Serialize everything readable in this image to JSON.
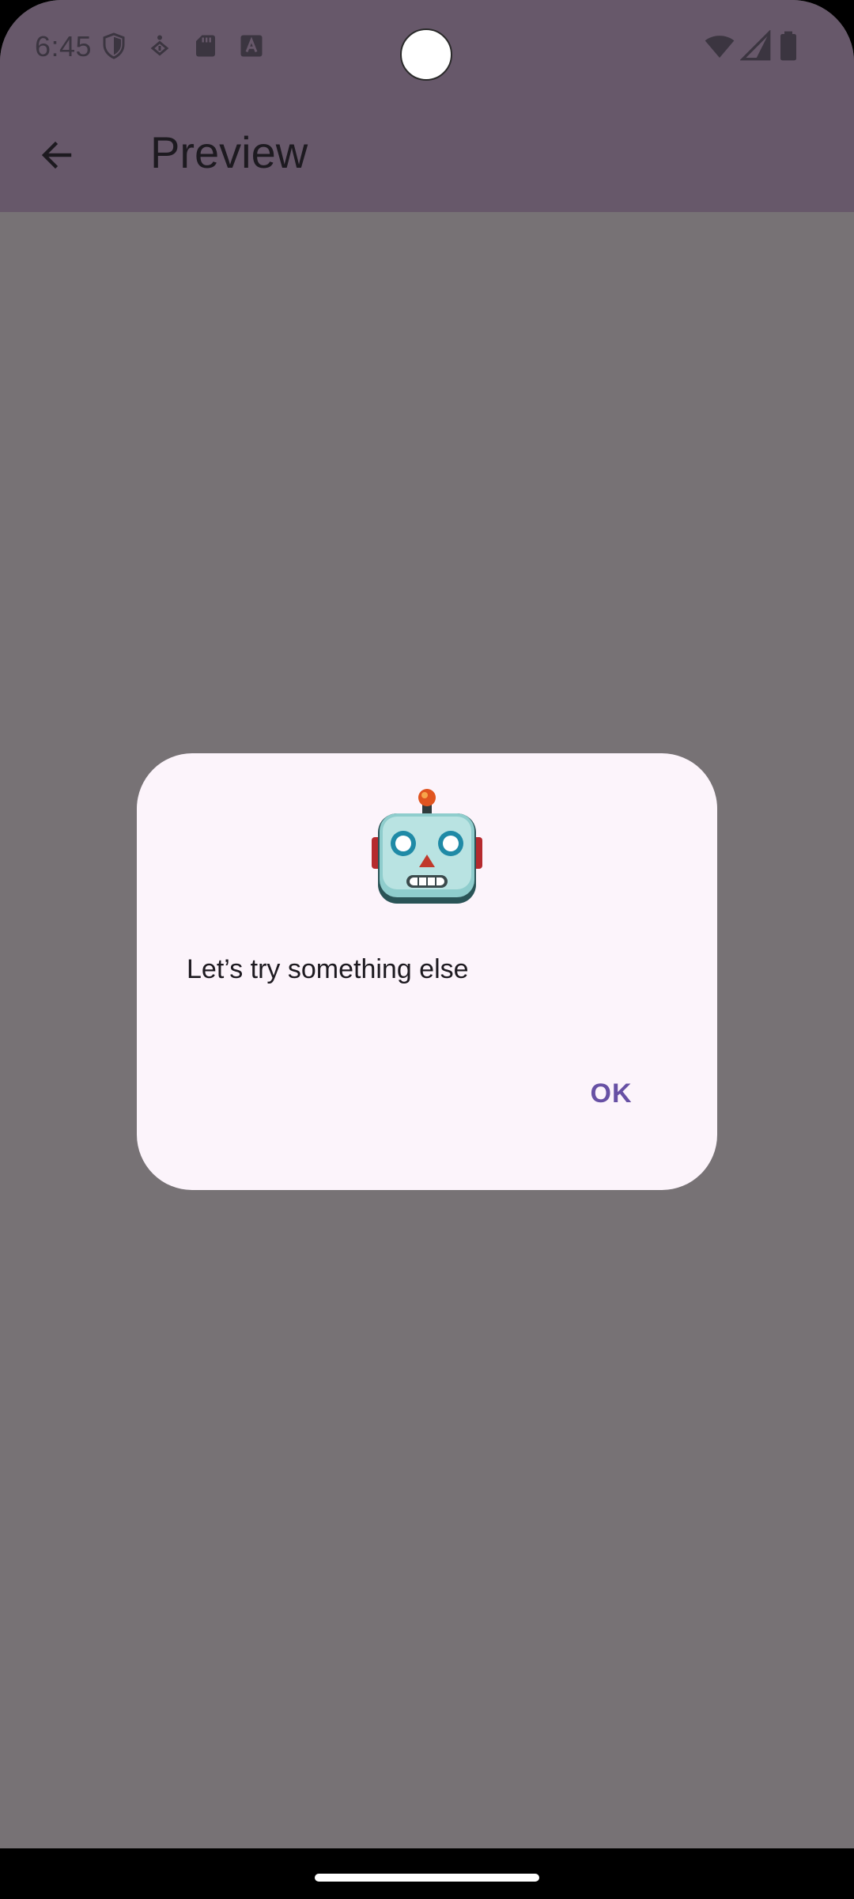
{
  "status_bar": {
    "time": "6:45",
    "left_icons": [
      "shield-icon",
      "accessibility-download-icon",
      "sd-card-icon",
      "text-a-icon"
    ],
    "right_icons": [
      "wifi-icon",
      "signal-icon",
      "battery-icon"
    ]
  },
  "app_bar": {
    "back_icon": "arrow-back-icon",
    "title": "Preview"
  },
  "dialog": {
    "icon": "robot-emoji",
    "message": "Let’s try something else",
    "ok_label": "OK"
  },
  "colors": {
    "app_bar": "#67586a",
    "scrim": "#777275",
    "dialog_background": "#fcf4fb",
    "accent": "#6750a4"
  }
}
